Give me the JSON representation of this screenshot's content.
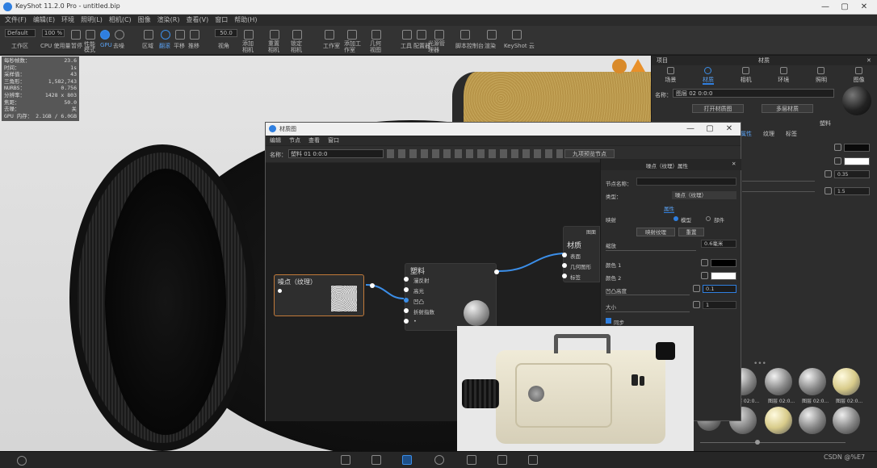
{
  "titlebar": {
    "title": "KeyShot 11.2.0 Pro - untitled.bip",
    "min": "—",
    "max": "▢",
    "close": "✕"
  },
  "menubar": [
    "文件(F)",
    "编辑(E)",
    "环境",
    "照明(L)",
    "相机(C)",
    "图像",
    "渲染(R)",
    "查看(V)",
    "窗口",
    "帮助(H)"
  ],
  "toolbar": {
    "workspace_select": "Default",
    "workspace_label": "工作区",
    "percent": "100 %",
    "cpu_label": "CPU 使用量",
    "pause_label": "暂停",
    "perf_label": "性能模式",
    "gpu_label": "GPU",
    "denoise_label": "去噪",
    "region_label": "区域",
    "move_label": "翻滚",
    "pan_label": "平移",
    "zoom_label": "推移",
    "fov": "50.0",
    "angle_label": "视角",
    "add_cam_label": "添加相机",
    "reset_cam_label": "重置相机",
    "lock_cam_label": "锁定相机",
    "workspace2": "工作室",
    "add_workspace": "添加工作室",
    "geom_view": "几何视图",
    "tools": "工具",
    "configurator": "配置器",
    "light_manager": "光源管理器",
    "script": "脚本控制台",
    "cloud": "KeyShot 云",
    "render_btn": "渲染",
    "material_lib": "材质库"
  },
  "stats": [
    {
      "k": "每秒帧数：",
      "v": "23.6"
    },
    {
      "k": "时间：",
      "v": "1s"
    },
    {
      "k": "采样值：",
      "v": "43"
    },
    {
      "k": "三角形：",
      "v": "1,582,743"
    },
    {
      "k": "NURBS：",
      "v": "0.756"
    },
    {
      "k": "分辨率：",
      "v": "1428 x 803"
    },
    {
      "k": "焦距：",
      "v": "50.0"
    },
    {
      "k": "去噪：",
      "v": "关"
    },
    {
      "k": "GPU 内存：",
      "v": "2.1GB / 6.0GB"
    }
  ],
  "material_graph": {
    "title": "材质图",
    "menu": [
      "编辑",
      "节点",
      "查看",
      "窗口"
    ],
    "name_label": "名称：",
    "name_value": "塑料 01 0:0:0",
    "preview_btn": "九项预览节点",
    "node_texture": {
      "title": "噪点（纹理）"
    },
    "node_plastic": {
      "title": "塑料",
      "ports": [
        "漫反射",
        "高光",
        "凹凸",
        "折射指数",
        "•"
      ]
    },
    "node_material": {
      "title": "材质",
      "sub": "图面",
      "ports": [
        "表面",
        "几何图形",
        "标签"
      ]
    }
  },
  "props_panel": {
    "title": "噪点（纹理）属性",
    "node_name_label": "节点名称：",
    "type_label": "类型：",
    "type_value": "噪点（纹理）",
    "tab": "属性",
    "mapping_label": "映射",
    "radio_model": "模型",
    "radio_part": "部件",
    "btn_mapping": "映射纹理",
    "btn_reset": "重置",
    "scale_label": "缩放",
    "scale_value": "0.6毫米",
    "color1_label": "颜色 1",
    "color2_label": "颜色 2",
    "bump_label": "凹凸高度",
    "bump_value": "0.1",
    "size_label": "大小",
    "size_value": "1",
    "sync_label": "同步"
  },
  "right_panel": {
    "header_left": "项目",
    "header_center": "材质",
    "tabs": [
      "场景",
      "材质",
      "相机",
      "环境",
      "照明",
      "图像"
    ],
    "name_label": "名称：",
    "name_value": "图层 02 0:0:0",
    "btn_graph": "打开材质图",
    "btn_multi": "多层材质",
    "type_label": "塑料",
    "subtabs": [
      "属性",
      "纹理",
      "标签"
    ],
    "val1": "0.35",
    "val2": "1.5",
    "thumb_labels": [
      "图层 02:0...",
      "图层 02:0...",
      "图层 02:0...",
      "图层 02:0...",
      "图层 02:0..."
    ]
  },
  "watermark": "CSDN @%E7",
  "colors": {
    "accent": "#2f7fe0",
    "node_selected": "#c27a3a"
  }
}
